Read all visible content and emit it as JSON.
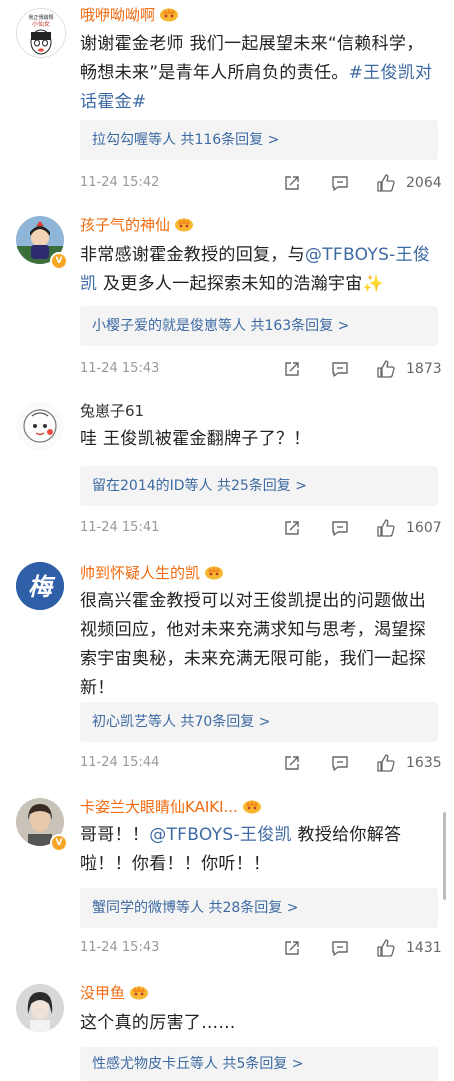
{
  "colors": {
    "vip_name": "#f26b0f",
    "link": "#3d6aa3",
    "reply_bg": "#f4f4f4",
    "meta": "#999999"
  },
  "comments": [
    {
      "username": "哦咿呦呦啊",
      "text_parts": [
        "谢谢霍金老师 我们一起展望未来“信赖科学，畅想未来”是青年人所肩负的责任。",
        "#王俊凯对话霍金#"
      ],
      "reply": {
        "who": "拉勾勾喔",
        "rest": "等人 共116条回复 >"
      },
      "time": "11-24 15:42",
      "likes": "2064",
      "avatar_text": [
        "我正傳銷類",
        "小仙女"
      ]
    },
    {
      "username": "孩子气的神仙",
      "text_parts": [
        "非常感谢霍金教授的回复，与",
        "@TFBOYS-王俊凯",
        " 及更多人一起探索未知的浩瀚宇宙✨"
      ],
      "reply": {
        "who": "小樱子爱的就是俊崽",
        "rest": "等人 共163条回复 >"
      },
      "time": "11-24 15:43",
      "likes": "1873"
    },
    {
      "username": "兔崽子61",
      "text_parts": [
        "哇 王俊凯被霍金翻牌子了？！"
      ],
      "reply": {
        "who": "留在2014的ID",
        "rest": "等人 共25条回复 >"
      },
      "time": "11-24 15:41",
      "likes": "1607"
    },
    {
      "username": "帅到怀疑人生的凯",
      "text_parts": [
        "很高兴霍金教授可以对王俊凯提出的问题做出视频回应，他对未来充满求知与思考，渴望探索宇宙奥秘，未来充满无限可能，我们一起探新！"
      ],
      "reply": {
        "who": "初心凯艺",
        "rest": "等人 共70条回复 >"
      },
      "time": "11-24 15:44",
      "likes": "1635",
      "avatar_text": [
        "梅"
      ]
    },
    {
      "username": "卡姿兰大眼睛仙KAIKI...",
      "text_parts": [
        "哥哥！！",
        "@TFBOYS-王俊凯",
        " 教授给你解答啦！！你看！！你听！！"
      ],
      "reply": {
        "who": "蟹同学的微博",
        "rest": "等人 共28条回复 >"
      },
      "time": "11-24 15:43",
      "likes": "1431"
    },
    {
      "username": "没甲鱼",
      "text_parts": [
        "这个真的厉害了……"
      ],
      "reply": {
        "who": "性感尤物皮卡丘",
        "rest": "等人 共5条回复 >"
      }
    }
  ]
}
